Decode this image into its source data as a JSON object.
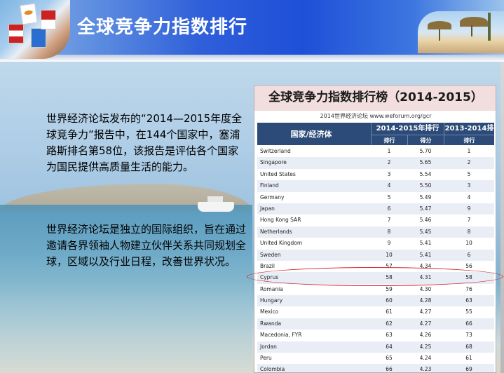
{
  "page": {
    "title": "全球竞争力指数排行"
  },
  "paragraphs": [
    "世界经济论坛发布的“2014—2015年度全球竞争力”报告中，在144个国家中，塞浦路斯排名第58位，该报告是评估各个国家为国民提供高质量生活的能力。",
    "世界经济论坛是独立的国际组织，旨在通过邀请各界领袖人物建立伙伴关系共同规划全球，区域以及行业日程，改善世界状况。"
  ],
  "table": {
    "title": "全球竞争力指数排行榜（2014-2015）",
    "subtitle": "2014世界经济论坛 www.weforum.org/gcr",
    "header": {
      "country": "国家/经济体",
      "group_current": "2014-2015年排行",
      "group_previous": "2013-2014排行",
      "rank": "排行",
      "score": "得分",
      "prev_rank": "排行"
    },
    "highlight_country": "Cyprus",
    "rows": [
      {
        "country": "Switzerland",
        "rank": "1",
        "score": "5.70",
        "prev": "1"
      },
      {
        "country": "Singapore",
        "rank": "2",
        "score": "5.65",
        "prev": "2"
      },
      {
        "country": "United States",
        "rank": "3",
        "score": "5.54",
        "prev": "5"
      },
      {
        "country": "Finland",
        "rank": "4",
        "score": "5.50",
        "prev": "3"
      },
      {
        "country": "Germany",
        "rank": "5",
        "score": "5.49",
        "prev": "4"
      },
      {
        "country": "Japan",
        "rank": "6",
        "score": "5.47",
        "prev": "9"
      },
      {
        "country": "Hong Kong SAR",
        "rank": "7",
        "score": "5.46",
        "prev": "7"
      },
      {
        "country": "Netherlands",
        "rank": "8",
        "score": "5.45",
        "prev": "8"
      },
      {
        "country": "United Kingdom",
        "rank": "9",
        "score": "5.41",
        "prev": "10"
      },
      {
        "country": "Sweden",
        "rank": "10",
        "score": "5.41",
        "prev": "6"
      },
      {
        "country": "Brazil",
        "rank": "57",
        "score": "4.34",
        "prev": "56"
      },
      {
        "country": "Cyprus",
        "rank": "58",
        "score": "4.31",
        "prev": "58"
      },
      {
        "country": "Romania",
        "rank": "59",
        "score": "4.30",
        "prev": "76"
      },
      {
        "country": "Hungary",
        "rank": "60",
        "score": "4.28",
        "prev": "63"
      },
      {
        "country": "Mexico",
        "rank": "61",
        "score": "4.27",
        "prev": "55"
      },
      {
        "country": "Rwanda",
        "rank": "62",
        "score": "4.27",
        "prev": "66"
      },
      {
        "country": "Macedonia, FYR",
        "rank": "63",
        "score": "4.26",
        "prev": "73"
      },
      {
        "country": "Jordan",
        "rank": "64",
        "score": "4.25",
        "prev": "68"
      },
      {
        "country": "Peru",
        "rank": "65",
        "score": "4.24",
        "prev": "61"
      },
      {
        "country": "Colombia",
        "rank": "66",
        "score": "4.23",
        "prev": "69"
      }
    ]
  },
  "colors": {
    "header_bar": "#1e4fd8",
    "table_header": "#2c4b78",
    "table_title_bg": "#f2dede",
    "highlight": "#d2282e"
  }
}
